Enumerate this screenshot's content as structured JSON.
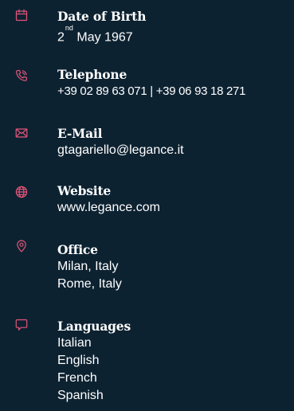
{
  "theme": {
    "background": "#0d2231",
    "accent": "#e0557a",
    "text": "#ffffff"
  },
  "items": [
    {
      "icon": "calendar-icon",
      "label": "Date of Birth",
      "value_prefix": "2",
      "value_ordinal": "nd",
      "value_suffix": " May 1967"
    },
    {
      "icon": "phone-icon",
      "label": "Telephone",
      "values": [
        "+39 02 89 63 071 | +39 06 93 18 271"
      ]
    },
    {
      "icon": "envelope-icon",
      "label": "E-Mail",
      "values": [
        "gtagariello@legance.it"
      ]
    },
    {
      "icon": "globe-icon",
      "label": "Website",
      "values": [
        "www.legance.com"
      ]
    },
    {
      "icon": "location-pin-icon",
      "label": "Office",
      "values": [
        "Milan, Italy",
        "Rome, Italy"
      ]
    },
    {
      "icon": "chat-bubble-icon",
      "label": "Languages",
      "values": [
        "Italian",
        "English",
        "French",
        "Spanish"
      ]
    }
  ]
}
